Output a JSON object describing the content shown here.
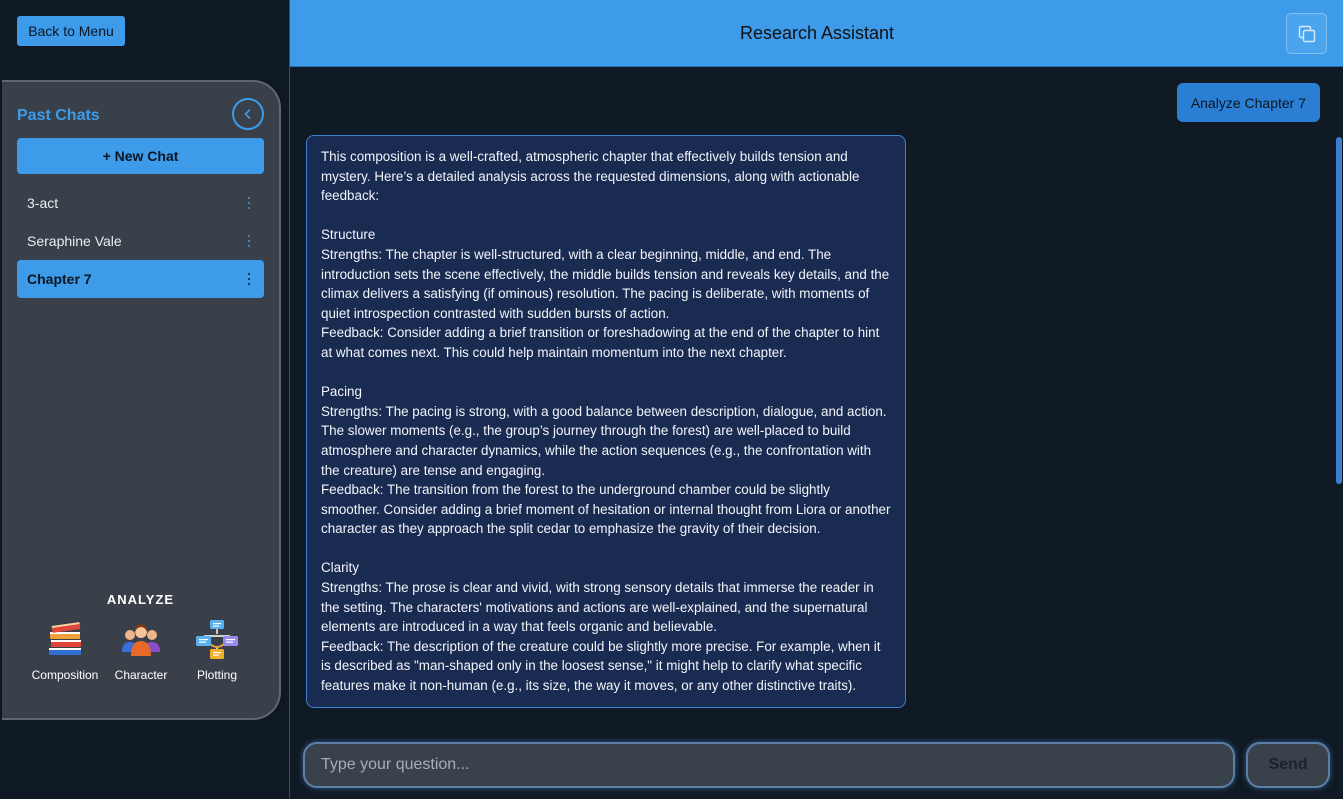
{
  "app": {
    "back_label": "Back to Menu"
  },
  "sidebar": {
    "title": "Past Chats",
    "new_chat_label": "+ New Chat",
    "chats": [
      {
        "label": "3-act",
        "active": false
      },
      {
        "label": "Seraphine Vale",
        "active": false
      },
      {
        "label": "Chapter 7",
        "active": true
      }
    ],
    "analyze": {
      "title": "ANALYZE",
      "tools": [
        {
          "label": "Composition",
          "icon": "books-icon"
        },
        {
          "label": "Character",
          "icon": "people-icon"
        },
        {
          "label": "Plotting",
          "icon": "flowchart-icon"
        }
      ]
    }
  },
  "header": {
    "title": "Research Assistant",
    "icon": "copy-icon"
  },
  "conversation": {
    "user_message": "Analyze Chapter 7",
    "assistant_lines": [
      "This composition is a well-crafted, atmospheric chapter that effectively builds tension and mystery. Here’s a detailed analysis across the requested dimensions, along with actionable feedback:",
      "",
      "Structure",
      "Strengths: The chapter is well-structured, with a clear beginning, middle, and end. The introduction sets the scene effectively, the middle builds tension and reveals key details, and the climax delivers a satisfying (if ominous) resolution. The pacing is deliberate, with moments of quiet introspection contrasted with sudden bursts of action.",
      "Feedback: Consider adding a brief transition or foreshadowing at the end of the chapter to hint at what comes next. This could help maintain momentum into the next chapter.",
      "",
      "Pacing",
      "Strengths: The pacing is strong, with a good balance between description, dialogue, and action. The slower moments (e.g., the group’s journey through the forest) are well-placed to build atmosphere and character dynamics, while the action sequences (e.g., the confrontation with the creature) are tense and engaging.",
      "Feedback: The transition from the forest to the underground chamber could be slightly smoother. Consider adding a brief moment of hesitation or internal thought from Liora or another character as they approach the split cedar to emphasize the gravity of their decision.",
      "",
      "Clarity",
      "Strengths: The prose is clear and vivid, with strong sensory details that immerse the reader in the setting. The characters' motivations and actions are well-explained, and the supernatural elements are introduced in a way that feels organic and believable.",
      "Feedback: The description of the creature could be slightly more precise. For example, when it is described as \"man-shaped only in the loosest sense,\" it might help to clarify what specific features make it non-human (e.g., its size, the way it moves, or any other distinctive traits)."
    ]
  },
  "composer": {
    "placeholder": "Type your question...",
    "send_label": "Send"
  },
  "colors": {
    "accent": "#3d9be9",
    "background": "#101a24",
    "sidebar_bg": "#3a4049",
    "assistant_bubble": "#1a2b52",
    "user_bubble": "#2a7fd4"
  }
}
